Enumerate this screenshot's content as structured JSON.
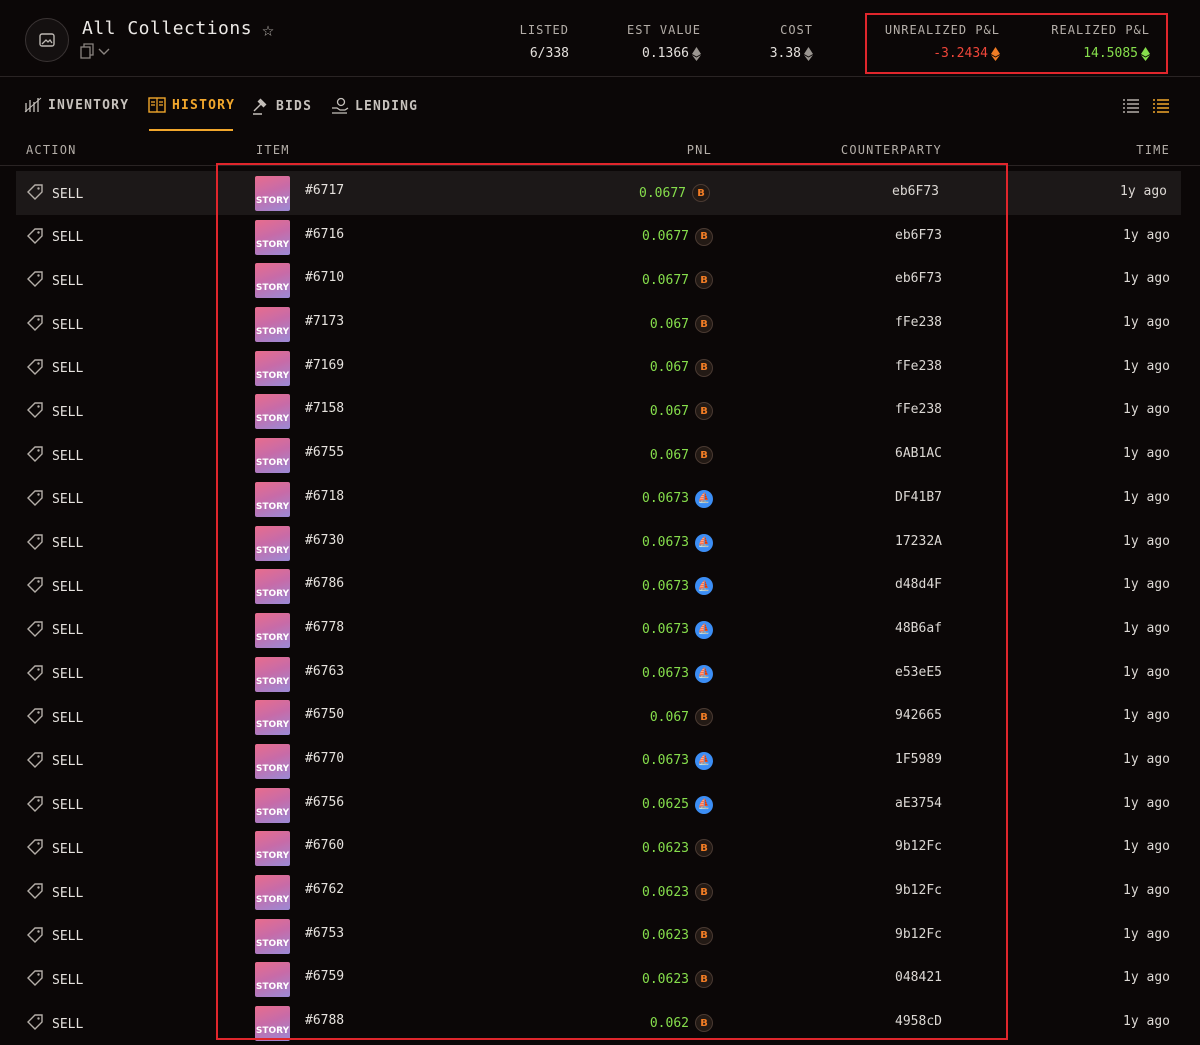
{
  "header": {
    "title": "All Collections",
    "stats": {
      "listed": {
        "label": "LISTED",
        "value": "6/338"
      },
      "est_value": {
        "label": "EST VALUE",
        "value": "0.1366"
      },
      "cost": {
        "label": "COST",
        "value": "3.38"
      },
      "unrealized": {
        "label": "UNREALIZED P&L",
        "value": "-3.2434"
      },
      "realized": {
        "label": "REALIZED P&L",
        "value": "14.5085"
      }
    }
  },
  "tabs": [
    {
      "label": "INVENTORY"
    },
    {
      "label": "HISTORY"
    },
    {
      "label": "BIDS"
    },
    {
      "label": "LENDING"
    }
  ],
  "columns": {
    "action": "ACTION",
    "item": "ITEM",
    "pnl": "PNL",
    "counterparty": "COUNTERPARTY",
    "time": "TIME"
  },
  "thumb_text": "STORY",
  "rows": [
    {
      "action": "SELL",
      "item": "#6717",
      "pnl": "0.0677",
      "marketplace": "orange",
      "counterparty": "eb6F73",
      "time": "1y ago"
    },
    {
      "action": "SELL",
      "item": "#6716",
      "pnl": "0.0677",
      "marketplace": "orange",
      "counterparty": "eb6F73",
      "time": "1y ago"
    },
    {
      "action": "SELL",
      "item": "#6710",
      "pnl": "0.0677",
      "marketplace": "orange",
      "counterparty": "eb6F73",
      "time": "1y ago"
    },
    {
      "action": "SELL",
      "item": "#7173",
      "pnl": "0.067",
      "marketplace": "orange",
      "counterparty": "fFe238",
      "time": "1y ago"
    },
    {
      "action": "SELL",
      "item": "#7169",
      "pnl": "0.067",
      "marketplace": "orange",
      "counterparty": "fFe238",
      "time": "1y ago"
    },
    {
      "action": "SELL",
      "item": "#7158",
      "pnl": "0.067",
      "marketplace": "orange",
      "counterparty": "fFe238",
      "time": "1y ago"
    },
    {
      "action": "SELL",
      "item": "#6755",
      "pnl": "0.067",
      "marketplace": "orange",
      "counterparty": "6AB1AC",
      "time": "1y ago"
    },
    {
      "action": "SELL",
      "item": "#6718",
      "pnl": "0.0673",
      "marketplace": "blue",
      "counterparty": "DF41B7",
      "time": "1y ago"
    },
    {
      "action": "SELL",
      "item": "#6730",
      "pnl": "0.0673",
      "marketplace": "blue",
      "counterparty": "17232A",
      "time": "1y ago"
    },
    {
      "action": "SELL",
      "item": "#6786",
      "pnl": "0.0673",
      "marketplace": "blue",
      "counterparty": "d48d4F",
      "time": "1y ago"
    },
    {
      "action": "SELL",
      "item": "#6778",
      "pnl": "0.0673",
      "marketplace": "blue",
      "counterparty": "48B6af",
      "time": "1y ago"
    },
    {
      "action": "SELL",
      "item": "#6763",
      "pnl": "0.0673",
      "marketplace": "blue",
      "counterparty": "e53eE5",
      "time": "1y ago"
    },
    {
      "action": "SELL",
      "item": "#6750",
      "pnl": "0.067",
      "marketplace": "orange",
      "counterparty": "942665",
      "time": "1y ago"
    },
    {
      "action": "SELL",
      "item": "#6770",
      "pnl": "0.0673",
      "marketplace": "blue",
      "counterparty": "1F5989",
      "time": "1y ago"
    },
    {
      "action": "SELL",
      "item": "#6756",
      "pnl": "0.0625",
      "marketplace": "blue",
      "counterparty": "aE3754",
      "time": "1y ago"
    },
    {
      "action": "SELL",
      "item": "#6760",
      "pnl": "0.0623",
      "marketplace": "orange",
      "counterparty": "9b12Fc",
      "time": "1y ago"
    },
    {
      "action": "SELL",
      "item": "#6762",
      "pnl": "0.0623",
      "marketplace": "orange",
      "counterparty": "9b12Fc",
      "time": "1y ago"
    },
    {
      "action": "SELL",
      "item": "#6753",
      "pnl": "0.0623",
      "marketplace": "orange",
      "counterparty": "9b12Fc",
      "time": "1y ago"
    },
    {
      "action": "SELL",
      "item": "#6759",
      "pnl": "0.0623",
      "marketplace": "orange",
      "counterparty": "048421",
      "time": "1y ago"
    },
    {
      "action": "SELL",
      "item": "#6788",
      "pnl": "0.062",
      "marketplace": "orange",
      "counterparty": "4958cD",
      "time": "1y ago"
    }
  ],
  "colors": {
    "accent": "#f2a72c",
    "positive": "#86de4c",
    "negative": "#f0463a",
    "highlight": "#e0262c"
  }
}
